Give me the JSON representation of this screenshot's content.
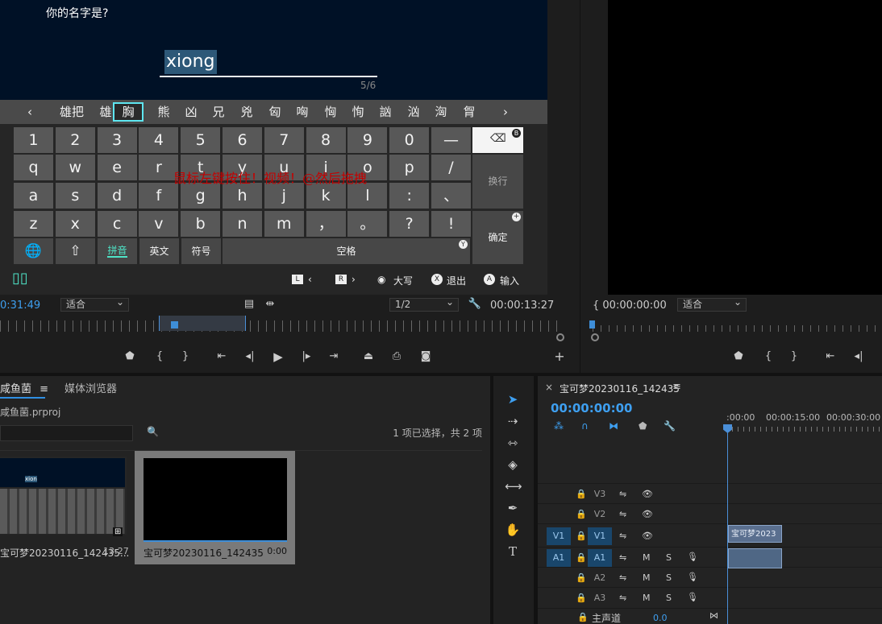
{
  "keyboard": {
    "prompt": "你的名字是?",
    "input": "xiong",
    "counter": "5/6",
    "candidates": [
      "雄把",
      "雄",
      "胸",
      "熊",
      "凶",
      "兄",
      "兇",
      "匈",
      "哅",
      "恟",
      "恂",
      "訩",
      "汹",
      "洶",
      "胷"
    ],
    "selected_candidate": "胸",
    "row_numbers": [
      "1",
      "2",
      "3",
      "4",
      "5",
      "6",
      "7",
      "8",
      "9",
      "0",
      "—"
    ],
    "row_q": [
      "q",
      "w",
      "e",
      "r",
      "t",
      "y",
      "u",
      "i",
      "o",
      "p",
      "/"
    ],
    "row_a": [
      "a",
      "s",
      "d",
      "f",
      "g",
      "h",
      "j",
      "k",
      "l",
      ":",
      "、"
    ],
    "row_z": [
      "z",
      "x",
      "c",
      "v",
      "b",
      "n",
      "m",
      "，",
      "。",
      "?",
      "!"
    ],
    "newline": "换行",
    "confirm": "确定",
    "pinyin": "拼音",
    "english": "英文",
    "symbols": "符号",
    "space": "空格",
    "backspace_badge": "B",
    "space_badge": "Y",
    "overlay_hint": "鼠标左键按住！视频！@然后拖拽",
    "nav_l": "L",
    "nav_r": "R",
    "caps_label": "大写",
    "exit_badge": "X",
    "exit_label": "退出",
    "input_badge": "A",
    "input_label": "输入"
  },
  "program_monitor": {
    "timecode_left": "0:31:49",
    "fit_label": "适合",
    "resolution": "1/2",
    "duration": "00:00:13:27"
  },
  "source_monitor": {
    "timecode": "00:00:00:00",
    "fit_label": "适合"
  },
  "project": {
    "tab_name": "咸鱼菌",
    "media_browser_tab": "媒体浏览器",
    "project_file": "咸鱼菌.prproj",
    "selection_status": "1 项已选择，共 2 项",
    "items": [
      {
        "name": "宝可梦20230116_142435...",
        "duration": "13:27",
        "thumb_text": "xion"
      },
      {
        "name": "宝可梦20230116_142435",
        "duration": "0:00"
      }
    ]
  },
  "timeline": {
    "tab_close": "×",
    "sequence_name": "宝可梦20230116_142435",
    "timecode": "00:00:00:00",
    "ruler_labels": [
      ":00:00",
      "00:00:15:00",
      "00:00:30:00"
    ],
    "tracks": [
      {
        "id": "V3",
        "src": ""
      },
      {
        "id": "V2",
        "src": ""
      },
      {
        "id": "V1",
        "src": "V1"
      },
      {
        "id": "A1",
        "src": "A1"
      },
      {
        "id": "A2",
        "src": ""
      },
      {
        "id": "A3",
        "src": ""
      }
    ],
    "clip_label": "宝可梦2023",
    "master_label": "主声道",
    "master_value": "0.0",
    "mute_label": "M",
    "solo_label": "S"
  }
}
